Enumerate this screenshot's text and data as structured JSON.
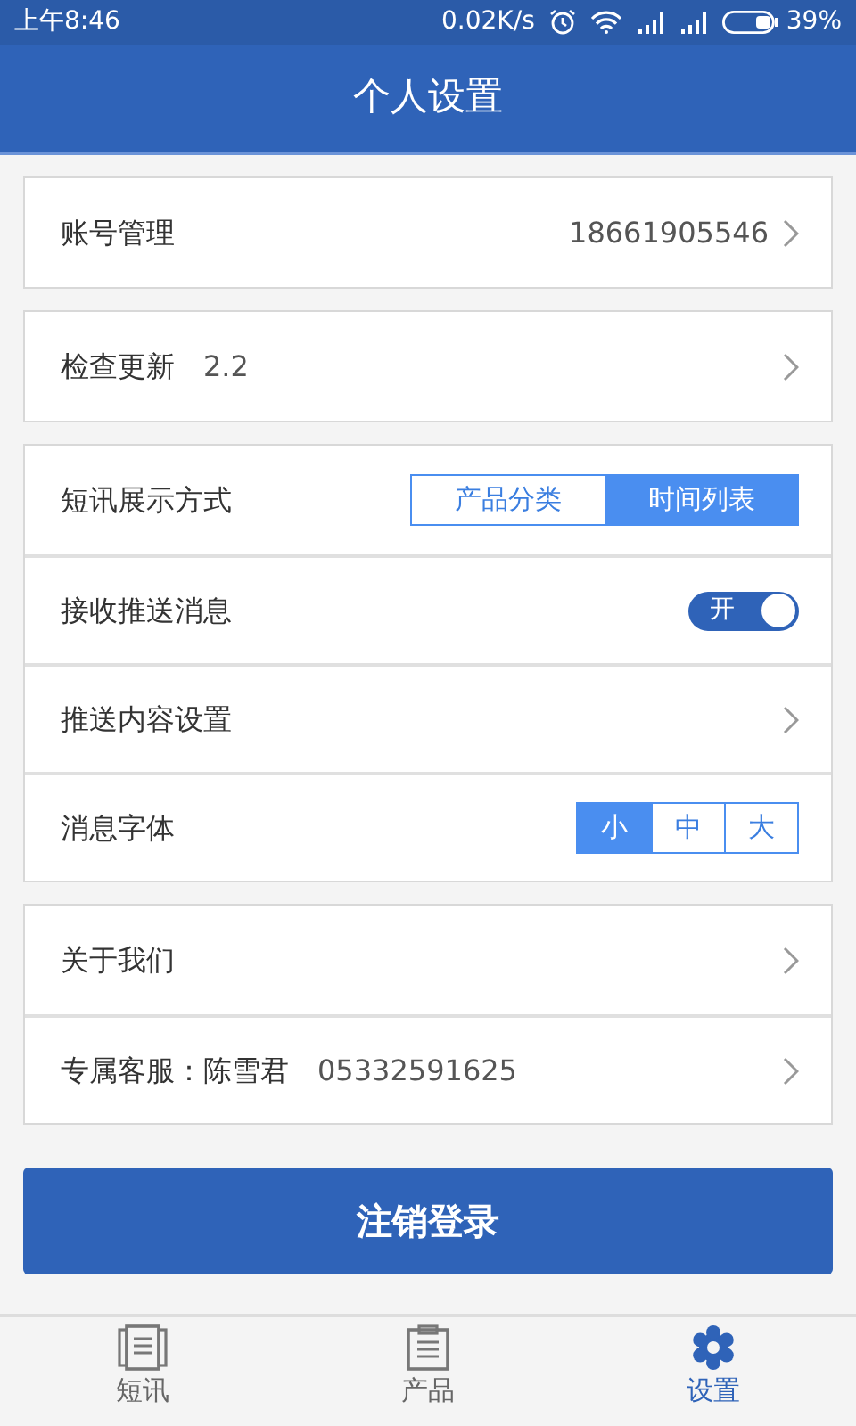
{
  "status_bar": {
    "time": "上午8:46",
    "speed": "0.02K/s",
    "battery": "39%"
  },
  "header": {
    "title": "个人设置"
  },
  "groups": [
    {
      "rows": [
        {
          "kind": "link",
          "label": "账号管理",
          "value": "18661905546"
        }
      ]
    },
    {
      "rows": [
        {
          "kind": "link",
          "label": "检查更新",
          "note": "2.2"
        }
      ]
    },
    {
      "rows": [
        {
          "kind": "segmented",
          "label": "短讯展示方式",
          "options": [
            {
              "label": "产品分类",
              "selected": false
            },
            {
              "label": "时间列表",
              "selected": true
            }
          ]
        },
        {
          "kind": "toggle",
          "label": "接收推送消息",
          "on": true,
          "toggle_text": "开"
        },
        {
          "kind": "link",
          "label": "推送内容设置"
        },
        {
          "kind": "segmented",
          "label": "消息字体",
          "options": [
            {
              "label": "小",
              "selected": true
            },
            {
              "label": "中",
              "selected": false
            },
            {
              "label": "大",
              "selected": false
            }
          ]
        }
      ]
    },
    {
      "rows": [
        {
          "kind": "link",
          "label": "关于我们"
        },
        {
          "kind": "link",
          "label": "专属客服：陈雪君",
          "note": "05332591625"
        }
      ]
    }
  ],
  "logout_button": "注销登录",
  "tab_bar": [
    {
      "label": "短讯",
      "selected": false
    },
    {
      "label": "产品",
      "selected": false
    },
    {
      "label": "设置",
      "selected": true
    }
  ]
}
